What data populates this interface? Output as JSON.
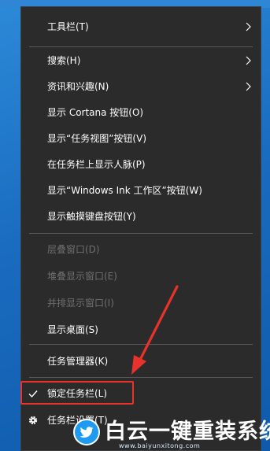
{
  "menu": {
    "items": [
      {
        "label": "工具栏(T)",
        "submenu": true,
        "disabled": false
      },
      {
        "label": "搜索(H)",
        "submenu": true,
        "disabled": false
      },
      {
        "label": "资讯和兴趣(N)",
        "submenu": true,
        "disabled": false
      },
      {
        "label": "显示 Cortana 按钮(O)",
        "submenu": false,
        "disabled": false
      },
      {
        "label": "显示“任务视图”按钮(V)",
        "submenu": false,
        "disabled": false
      },
      {
        "label": "在任务栏上显示人脉(P)",
        "submenu": false,
        "disabled": false
      },
      {
        "label": "显示“Windows Ink 工作区”按钮(W)",
        "submenu": false,
        "disabled": false
      },
      {
        "label": "显示触摸键盘按钮(Y)",
        "submenu": false,
        "disabled": false
      },
      {
        "label": "层叠窗口(D)",
        "submenu": false,
        "disabled": true
      },
      {
        "label": "堆叠显示窗口(E)",
        "submenu": false,
        "disabled": true
      },
      {
        "label": "并排显示窗口(I)",
        "submenu": false,
        "disabled": true
      },
      {
        "label": "显示桌面(S)",
        "submenu": false,
        "disabled": false
      },
      {
        "label": "任务管理器(K)",
        "submenu": false,
        "disabled": false
      },
      {
        "label": "锁定任务栏(L)",
        "submenu": false,
        "disabled": false,
        "checked": true
      },
      {
        "label": "任务栏设置(T)",
        "submenu": false,
        "disabled": false,
        "icon": "gear-icon"
      }
    ]
  },
  "watermark": {
    "text": "白云一键重装系统",
    "url": "www.baiyunxitong.com",
    "icon": "twitter-bird-icon"
  },
  "colors": {
    "menu_bg": "#2b2b2b",
    "text": "#ffffff",
    "disabled_text": "#6f6f6f",
    "separator": "#5a5a5a",
    "highlight": "#e8322b",
    "desktop": "#1a6cc0"
  }
}
